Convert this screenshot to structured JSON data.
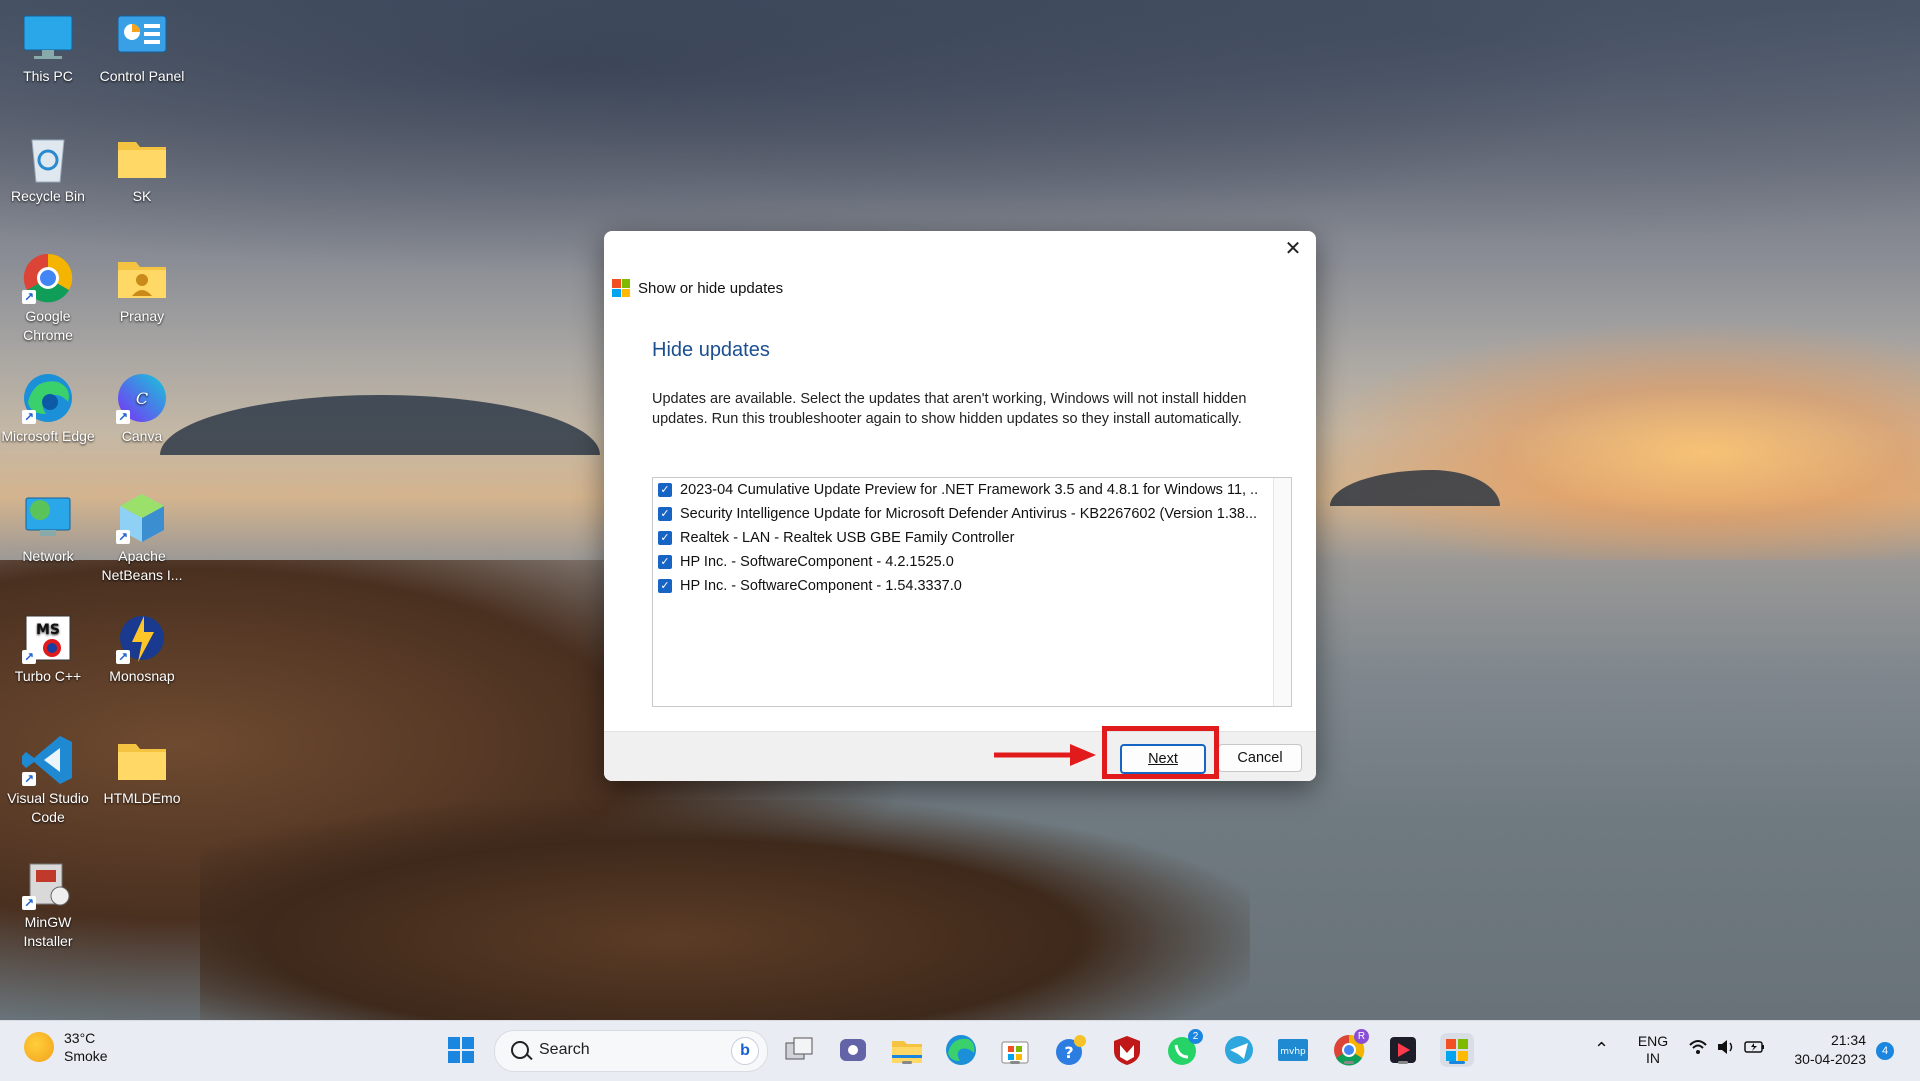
{
  "desktop": {
    "icons": [
      {
        "label": "This PC"
      },
      {
        "label": "Control Panel"
      },
      {
        "label": "Recycle Bin"
      },
      {
        "label": "SK"
      },
      {
        "label": "Google Chrome"
      },
      {
        "label": "Pranay"
      },
      {
        "label": "Microsoft Edge"
      },
      {
        "label": "Canva"
      },
      {
        "label": "Network"
      },
      {
        "label": "Apache NetBeans I..."
      },
      {
        "label": "Turbo C++"
      },
      {
        "label": "Monosnap"
      },
      {
        "label": "Visual Studio Code"
      },
      {
        "label": "HTMLDEmo"
      },
      {
        "label": "MinGW Installer"
      }
    ]
  },
  "dialog": {
    "window_title": "Show or hide updates",
    "close_glyph": "✕",
    "heading": "Hide updates",
    "description": "Updates are available. Select the updates that aren't working, Windows will not install hidden updates. Run this troubleshooter again to show hidden updates so they install automatically.",
    "updates": [
      {
        "label": "2023-04 Cumulative Update Preview for .NET Framework 3.5 and 4.8.1 for Windows 11, ...",
        "checked": true
      },
      {
        "label": "Security Intelligence Update for Microsoft Defender Antivirus - KB2267602 (Version 1.38...",
        "checked": true
      },
      {
        "label": "Realtek - LAN - Realtek USB GBE Family Controller",
        "checked": true
      },
      {
        "label": "HP Inc. - SoftwareComponent - 4.2.1525.0",
        "checked": true
      },
      {
        "label": "HP Inc. - SoftwareComponent - 1.54.3337.0",
        "checked": true
      }
    ],
    "next_label": "Next",
    "cancel_label": "Cancel"
  },
  "taskbar": {
    "weather_temp": "33°C",
    "weather_desc": "Smoke",
    "search_label": "Search",
    "bing_glyph": "b",
    "teams_badge": "",
    "whatsapp_badge": "2",
    "chrome_badge": "R",
    "lang_top": "ENG",
    "lang_bottom": "IN",
    "time": "21:34",
    "date": "30-04-2023",
    "notification_count": "4"
  },
  "colors": {
    "accent": "#1664c4",
    "heading_blue": "#1b4f8f",
    "annotation_red": "#e11b1b"
  }
}
